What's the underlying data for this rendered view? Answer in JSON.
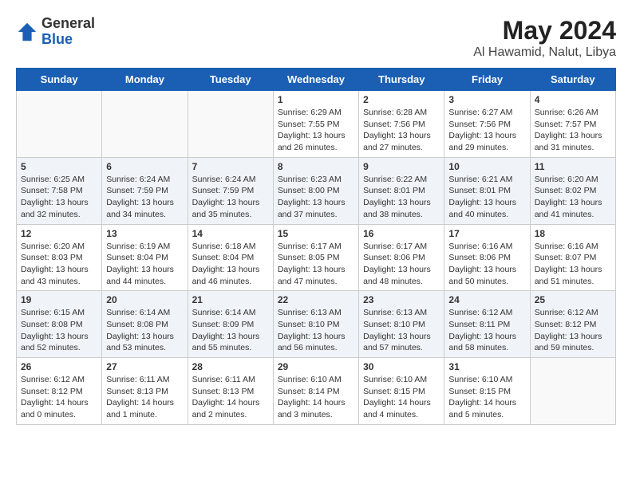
{
  "header": {
    "logo_line1": "General",
    "logo_line2": "Blue",
    "title": "May 2024",
    "subtitle": "Al Hawamid, Nalut, Libya"
  },
  "days_of_week": [
    "Sunday",
    "Monday",
    "Tuesday",
    "Wednesday",
    "Thursday",
    "Friday",
    "Saturday"
  ],
  "weeks": [
    [
      {
        "day": "",
        "info": ""
      },
      {
        "day": "",
        "info": ""
      },
      {
        "day": "",
        "info": ""
      },
      {
        "day": "1",
        "info": "Sunrise: 6:29 AM\nSunset: 7:55 PM\nDaylight: 13 hours\nand 26 minutes."
      },
      {
        "day": "2",
        "info": "Sunrise: 6:28 AM\nSunset: 7:56 PM\nDaylight: 13 hours\nand 27 minutes."
      },
      {
        "day": "3",
        "info": "Sunrise: 6:27 AM\nSunset: 7:56 PM\nDaylight: 13 hours\nand 29 minutes."
      },
      {
        "day": "4",
        "info": "Sunrise: 6:26 AM\nSunset: 7:57 PM\nDaylight: 13 hours\nand 31 minutes."
      }
    ],
    [
      {
        "day": "5",
        "info": "Sunrise: 6:25 AM\nSunset: 7:58 PM\nDaylight: 13 hours\nand 32 minutes."
      },
      {
        "day": "6",
        "info": "Sunrise: 6:24 AM\nSunset: 7:59 PM\nDaylight: 13 hours\nand 34 minutes."
      },
      {
        "day": "7",
        "info": "Sunrise: 6:24 AM\nSunset: 7:59 PM\nDaylight: 13 hours\nand 35 minutes."
      },
      {
        "day": "8",
        "info": "Sunrise: 6:23 AM\nSunset: 8:00 PM\nDaylight: 13 hours\nand 37 minutes."
      },
      {
        "day": "9",
        "info": "Sunrise: 6:22 AM\nSunset: 8:01 PM\nDaylight: 13 hours\nand 38 minutes."
      },
      {
        "day": "10",
        "info": "Sunrise: 6:21 AM\nSunset: 8:01 PM\nDaylight: 13 hours\nand 40 minutes."
      },
      {
        "day": "11",
        "info": "Sunrise: 6:20 AM\nSunset: 8:02 PM\nDaylight: 13 hours\nand 41 minutes."
      }
    ],
    [
      {
        "day": "12",
        "info": "Sunrise: 6:20 AM\nSunset: 8:03 PM\nDaylight: 13 hours\nand 43 minutes."
      },
      {
        "day": "13",
        "info": "Sunrise: 6:19 AM\nSunset: 8:04 PM\nDaylight: 13 hours\nand 44 minutes."
      },
      {
        "day": "14",
        "info": "Sunrise: 6:18 AM\nSunset: 8:04 PM\nDaylight: 13 hours\nand 46 minutes."
      },
      {
        "day": "15",
        "info": "Sunrise: 6:17 AM\nSunset: 8:05 PM\nDaylight: 13 hours\nand 47 minutes."
      },
      {
        "day": "16",
        "info": "Sunrise: 6:17 AM\nSunset: 8:06 PM\nDaylight: 13 hours\nand 48 minutes."
      },
      {
        "day": "17",
        "info": "Sunrise: 6:16 AM\nSunset: 8:06 PM\nDaylight: 13 hours\nand 50 minutes."
      },
      {
        "day": "18",
        "info": "Sunrise: 6:16 AM\nSunset: 8:07 PM\nDaylight: 13 hours\nand 51 minutes."
      }
    ],
    [
      {
        "day": "19",
        "info": "Sunrise: 6:15 AM\nSunset: 8:08 PM\nDaylight: 13 hours\nand 52 minutes."
      },
      {
        "day": "20",
        "info": "Sunrise: 6:14 AM\nSunset: 8:08 PM\nDaylight: 13 hours\nand 53 minutes."
      },
      {
        "day": "21",
        "info": "Sunrise: 6:14 AM\nSunset: 8:09 PM\nDaylight: 13 hours\nand 55 minutes."
      },
      {
        "day": "22",
        "info": "Sunrise: 6:13 AM\nSunset: 8:10 PM\nDaylight: 13 hours\nand 56 minutes."
      },
      {
        "day": "23",
        "info": "Sunrise: 6:13 AM\nSunset: 8:10 PM\nDaylight: 13 hours\nand 57 minutes."
      },
      {
        "day": "24",
        "info": "Sunrise: 6:12 AM\nSunset: 8:11 PM\nDaylight: 13 hours\nand 58 minutes."
      },
      {
        "day": "25",
        "info": "Sunrise: 6:12 AM\nSunset: 8:12 PM\nDaylight: 13 hours\nand 59 minutes."
      }
    ],
    [
      {
        "day": "26",
        "info": "Sunrise: 6:12 AM\nSunset: 8:12 PM\nDaylight: 14 hours\nand 0 minutes."
      },
      {
        "day": "27",
        "info": "Sunrise: 6:11 AM\nSunset: 8:13 PM\nDaylight: 14 hours\nand 1 minute."
      },
      {
        "day": "28",
        "info": "Sunrise: 6:11 AM\nSunset: 8:13 PM\nDaylight: 14 hours\nand 2 minutes."
      },
      {
        "day": "29",
        "info": "Sunrise: 6:10 AM\nSunset: 8:14 PM\nDaylight: 14 hours\nand 3 minutes."
      },
      {
        "day": "30",
        "info": "Sunrise: 6:10 AM\nSunset: 8:15 PM\nDaylight: 14 hours\nand 4 minutes."
      },
      {
        "day": "31",
        "info": "Sunrise: 6:10 AM\nSunset: 8:15 PM\nDaylight: 14 hours\nand 5 minutes."
      },
      {
        "day": "",
        "info": ""
      }
    ]
  ]
}
